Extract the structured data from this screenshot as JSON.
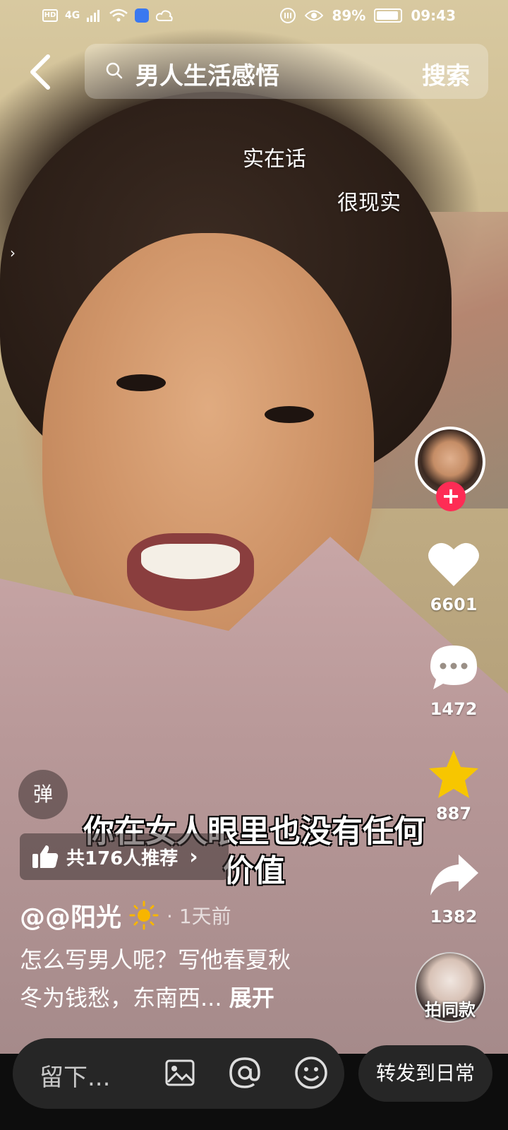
{
  "status_bar": {
    "left_badge": "HD",
    "network": "4G",
    "battery_percent": "89%",
    "time": "09:43"
  },
  "search": {
    "query": "男人生活感悟",
    "button": "搜索"
  },
  "danmaku": [
    "实在话",
    "很现实"
  ],
  "actions": {
    "likes": "6601",
    "comments": "1472",
    "favorites": "887",
    "shares": "1382"
  },
  "subtitle": [
    "你在女人眼里也没有任何",
    "价值"
  ],
  "danmaku_toggle": "弹",
  "recommend": "共176人推荐",
  "author": {
    "name": "@@阳光",
    "time": "· 1天前"
  },
  "description": {
    "line1": "怎么写男人呢？写他春夏秋",
    "line2": "冬为钱愁，东南西...",
    "more": "展开"
  },
  "same_style": "拍同款",
  "bottom": {
    "comment_placeholder": "留下...",
    "share_daily": "转发到日常"
  },
  "colors": {
    "follow_red": "#fe2c55",
    "favorite_yellow": "#f7c600"
  }
}
